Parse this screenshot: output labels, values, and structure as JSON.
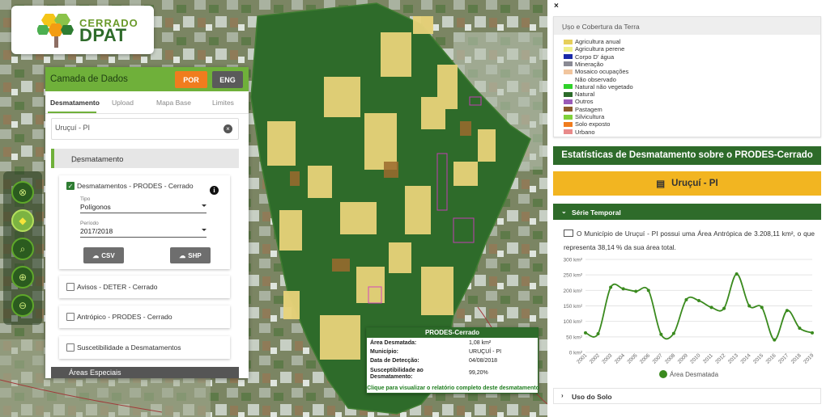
{
  "logo": {
    "line1": "CERRADO",
    "line2": "DPAT"
  },
  "panel": {
    "title": "Camada de Dados",
    "lang_por": "POR",
    "lang_eng": "ENG",
    "tabs": [
      "Desmatamento",
      "Upload",
      "Mapa Base",
      "Limites"
    ],
    "search_value": "Uruçuí - PI",
    "section_title": "Desmatamento",
    "layers": [
      {
        "label": "Desmatamentos - PRODES - Cerrado",
        "checked": true
      },
      {
        "label": "Avisos - DETER - Cerrado",
        "checked": false
      },
      {
        "label": "Antrópico - PRODES - Cerrado",
        "checked": false
      },
      {
        "label": "Suscetibilidade a Desmatamentos",
        "checked": false
      }
    ],
    "tipo_label": "Tipo",
    "tipo_value": "Polígonos",
    "periodo_label": "Período",
    "periodo_value": "2017/2018",
    "csv_label": "CSV",
    "shp_label": "SHP",
    "areas_especiais": "Áreas Especiais"
  },
  "popup": {
    "title": "PRODES-Cerrado",
    "rows": [
      {
        "key": "Área Desmatada:",
        "value": "1,08 km²"
      },
      {
        "key": "Município:",
        "value": "URUÇUÍ - PI"
      },
      {
        "key": "Data de Detecção:",
        "value": "04/08/2018"
      },
      {
        "key": "Susceptibilidade ao Desmatamento:",
        "value": "99,20%"
      }
    ],
    "link": "Clique para visualizar o relatório completo deste desmatamento"
  },
  "right": {
    "close": "×",
    "legend_title": "Uso e Cobertura da Terra",
    "legend": [
      {
        "label": "Agricultura anual",
        "color": "#e6cf5a"
      },
      {
        "label": "Agricultura perene",
        "color": "#eef08a"
      },
      {
        "label": "Corpo D' água",
        "color": "#1a2aa8"
      },
      {
        "label": "Mineração",
        "color": "#8a8a94"
      },
      {
        "label": "Mosaico ocupações",
        "color": "#f1c59e"
      },
      {
        "label": "Não observado",
        "color": "#ffffff"
      },
      {
        "label": "Natural não vegetado",
        "color": "#2fd12a"
      },
      {
        "label": "Natural",
        "color": "#2c6b2a"
      },
      {
        "label": "Outros",
        "color": "#9a5ab8"
      },
      {
        "label": "Pastagem",
        "color": "#8c5a2c"
      },
      {
        "label": "Silvicultura",
        "color": "#7fd13a"
      },
      {
        "label": "Solo exposto",
        "color": "#f07c1e"
      },
      {
        "label": "Urbano",
        "color": "#e88a8a"
      }
    ],
    "stats_title": "Estatísticas de Desmatamento sobre o PRODES-Cerrado",
    "municipio": "Uruçuí - PI",
    "serie_temporal": "Série Temporal",
    "description": "O Município de Uruçuí - PI possui uma Área Antrópica de 3.208,11 km², o que representa 38,14 % da sua área total.",
    "uso_do_solo": "Uso do Solo"
  },
  "chart_data": {
    "type": "line",
    "x": [
      "2001",
      "2002",
      "2003",
      "2004",
      "2005",
      "2006",
      "2007",
      "2008",
      "2009",
      "2010",
      "2011",
      "2012",
      "2013",
      "2014",
      "2015",
      "2016",
      "2017",
      "2018",
      "2019"
    ],
    "series": [
      {
        "name": "Área Desmatada",
        "values": [
          63,
          60,
          210,
          205,
          197,
          200,
          58,
          61,
          170,
          167,
          145,
          142,
          253,
          150,
          145,
          40,
          135,
          78,
          63
        ],
        "color": "#3a8a1e"
      }
    ],
    "ylim": [
      0,
      300
    ],
    "yticks": [
      "0 km²",
      "50 km²",
      "100 km²",
      "150 km²",
      "200 km²",
      "250 km²",
      "300 km²"
    ],
    "grid": true,
    "legend": "bottom"
  }
}
